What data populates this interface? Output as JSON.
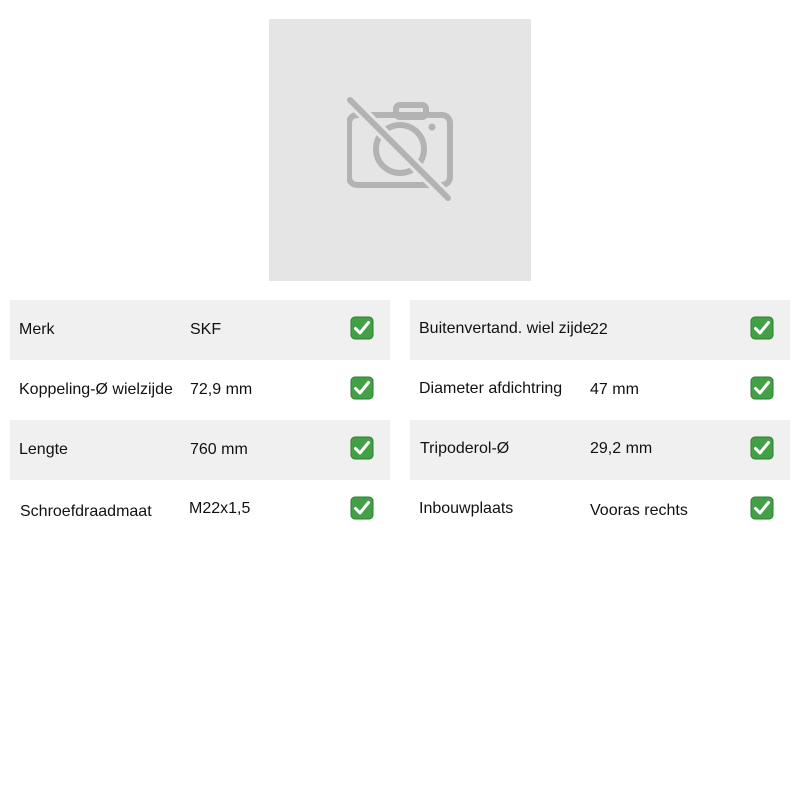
{
  "product_image": {
    "icon": "no-photo-icon",
    "background": "#e5e5e5",
    "icon_color": "#b3b3b3"
  },
  "specs_left": [
    {
      "label": "Merk",
      "value": "SKF",
      "icon": "check-icon"
    },
    {
      "label": "Koppeling-Ø wielzijde",
      "value": "72,9 mm",
      "icon": "check-icon"
    },
    {
      "label": "Lengte",
      "value": "760 mm",
      "icon": "check-icon"
    },
    {
      "label": "Schroefdraadmaat",
      "value": "M22x1,5",
      "icon": "check-icon"
    }
  ],
  "specs_right": [
    {
      "label": "Buitenvertand. wiel zijde",
      "value": "22",
      "icon": "check-icon"
    },
    {
      "label": "Diameter afdichtring",
      "value": "47 mm",
      "icon": "check-icon"
    },
    {
      "label": "Tripoderol-Ø",
      "value": "29,2 mm",
      "icon": "check-icon"
    },
    {
      "label": "Inbouwplaats",
      "value": "Vooras rechts",
      "icon": "check-icon"
    }
  ],
  "colors": {
    "row_shade": "#f0f0f0",
    "check_green": "#43a047"
  }
}
